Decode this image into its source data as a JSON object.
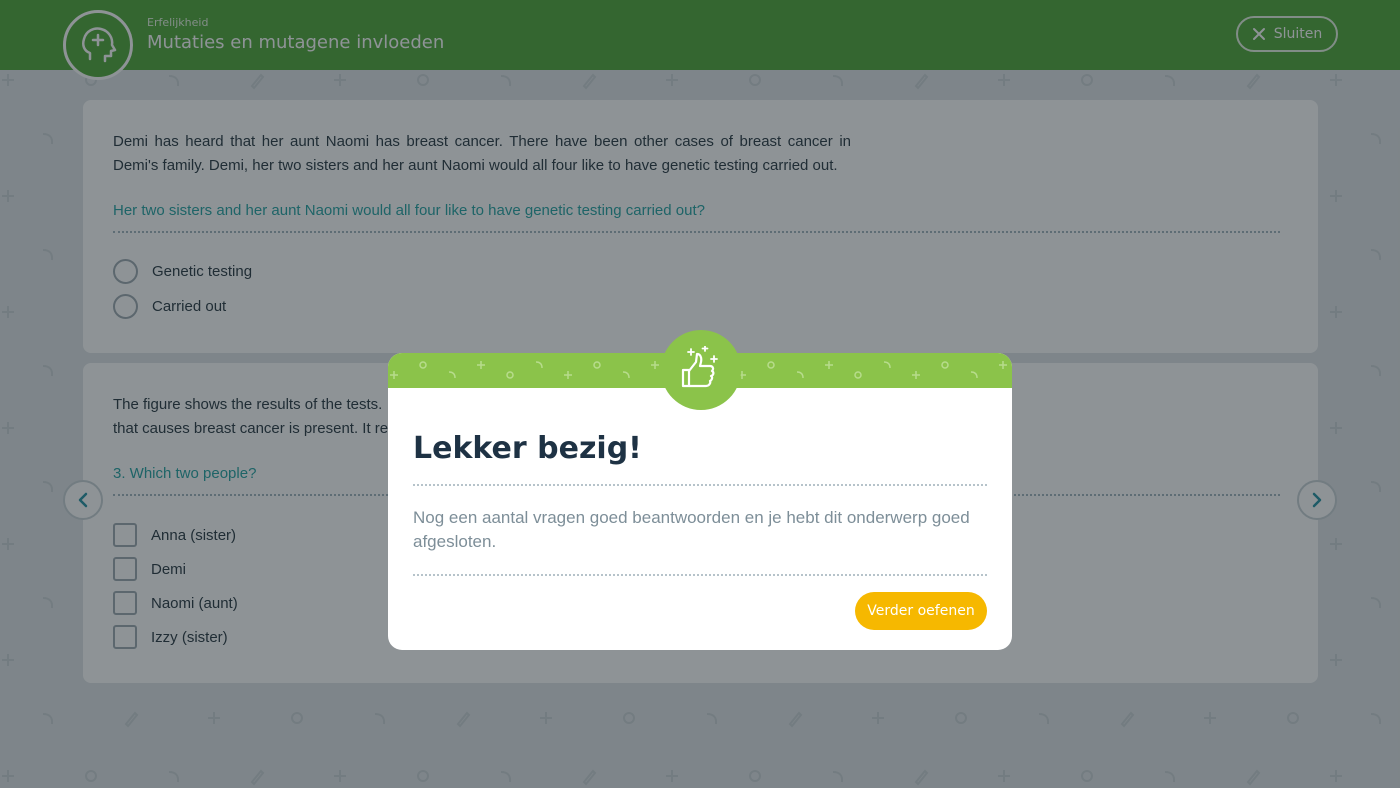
{
  "header": {
    "subtitle": "Erfelijkheid",
    "title": "Mutaties en mutagene invloeden",
    "close_label": "Sluiten"
  },
  "question1": {
    "passage": "Demi has heard that her aunt Naomi has breast cancer. There have been other cases of breast cancer in Demi's family. Demi, her two sisters and her aunt Naomi would all four like to have genetic testing carried out.",
    "prompt": "Her two sisters and her aunt Naomi would all four like to have genetic testing carried out?",
    "options": [
      "Genetic testing",
      "Carried out"
    ]
  },
  "question2": {
    "passage_line1": "The figure shows the results of the tests.",
    "passage_line2": "that causes breast cancer is present. It re",
    "prompt": "3. Which two people?",
    "options": [
      "Anna (sister)",
      "Demi",
      "Naomi (aunt)",
      "Izzy (sister)"
    ]
  },
  "modal": {
    "title": "Lekker bezig!",
    "message": "Nog een aantal vragen goed beantwoorden en je hebt dit onderwerp goed afgesloten.",
    "button_label": "Verder oefenen"
  },
  "icons": {
    "header_logo": "head-plus-icon",
    "close": "close-icon",
    "prev": "chevron-left-icon",
    "next": "chevron-right-icon",
    "badge": "thumbs-up-icon"
  },
  "colors": {
    "header_green": "#4aa533",
    "banner_green": "#8bc34a",
    "question_teal": "#1fa0a0",
    "button_yellow": "#f6b800",
    "title_navy": "#1e3244"
  }
}
